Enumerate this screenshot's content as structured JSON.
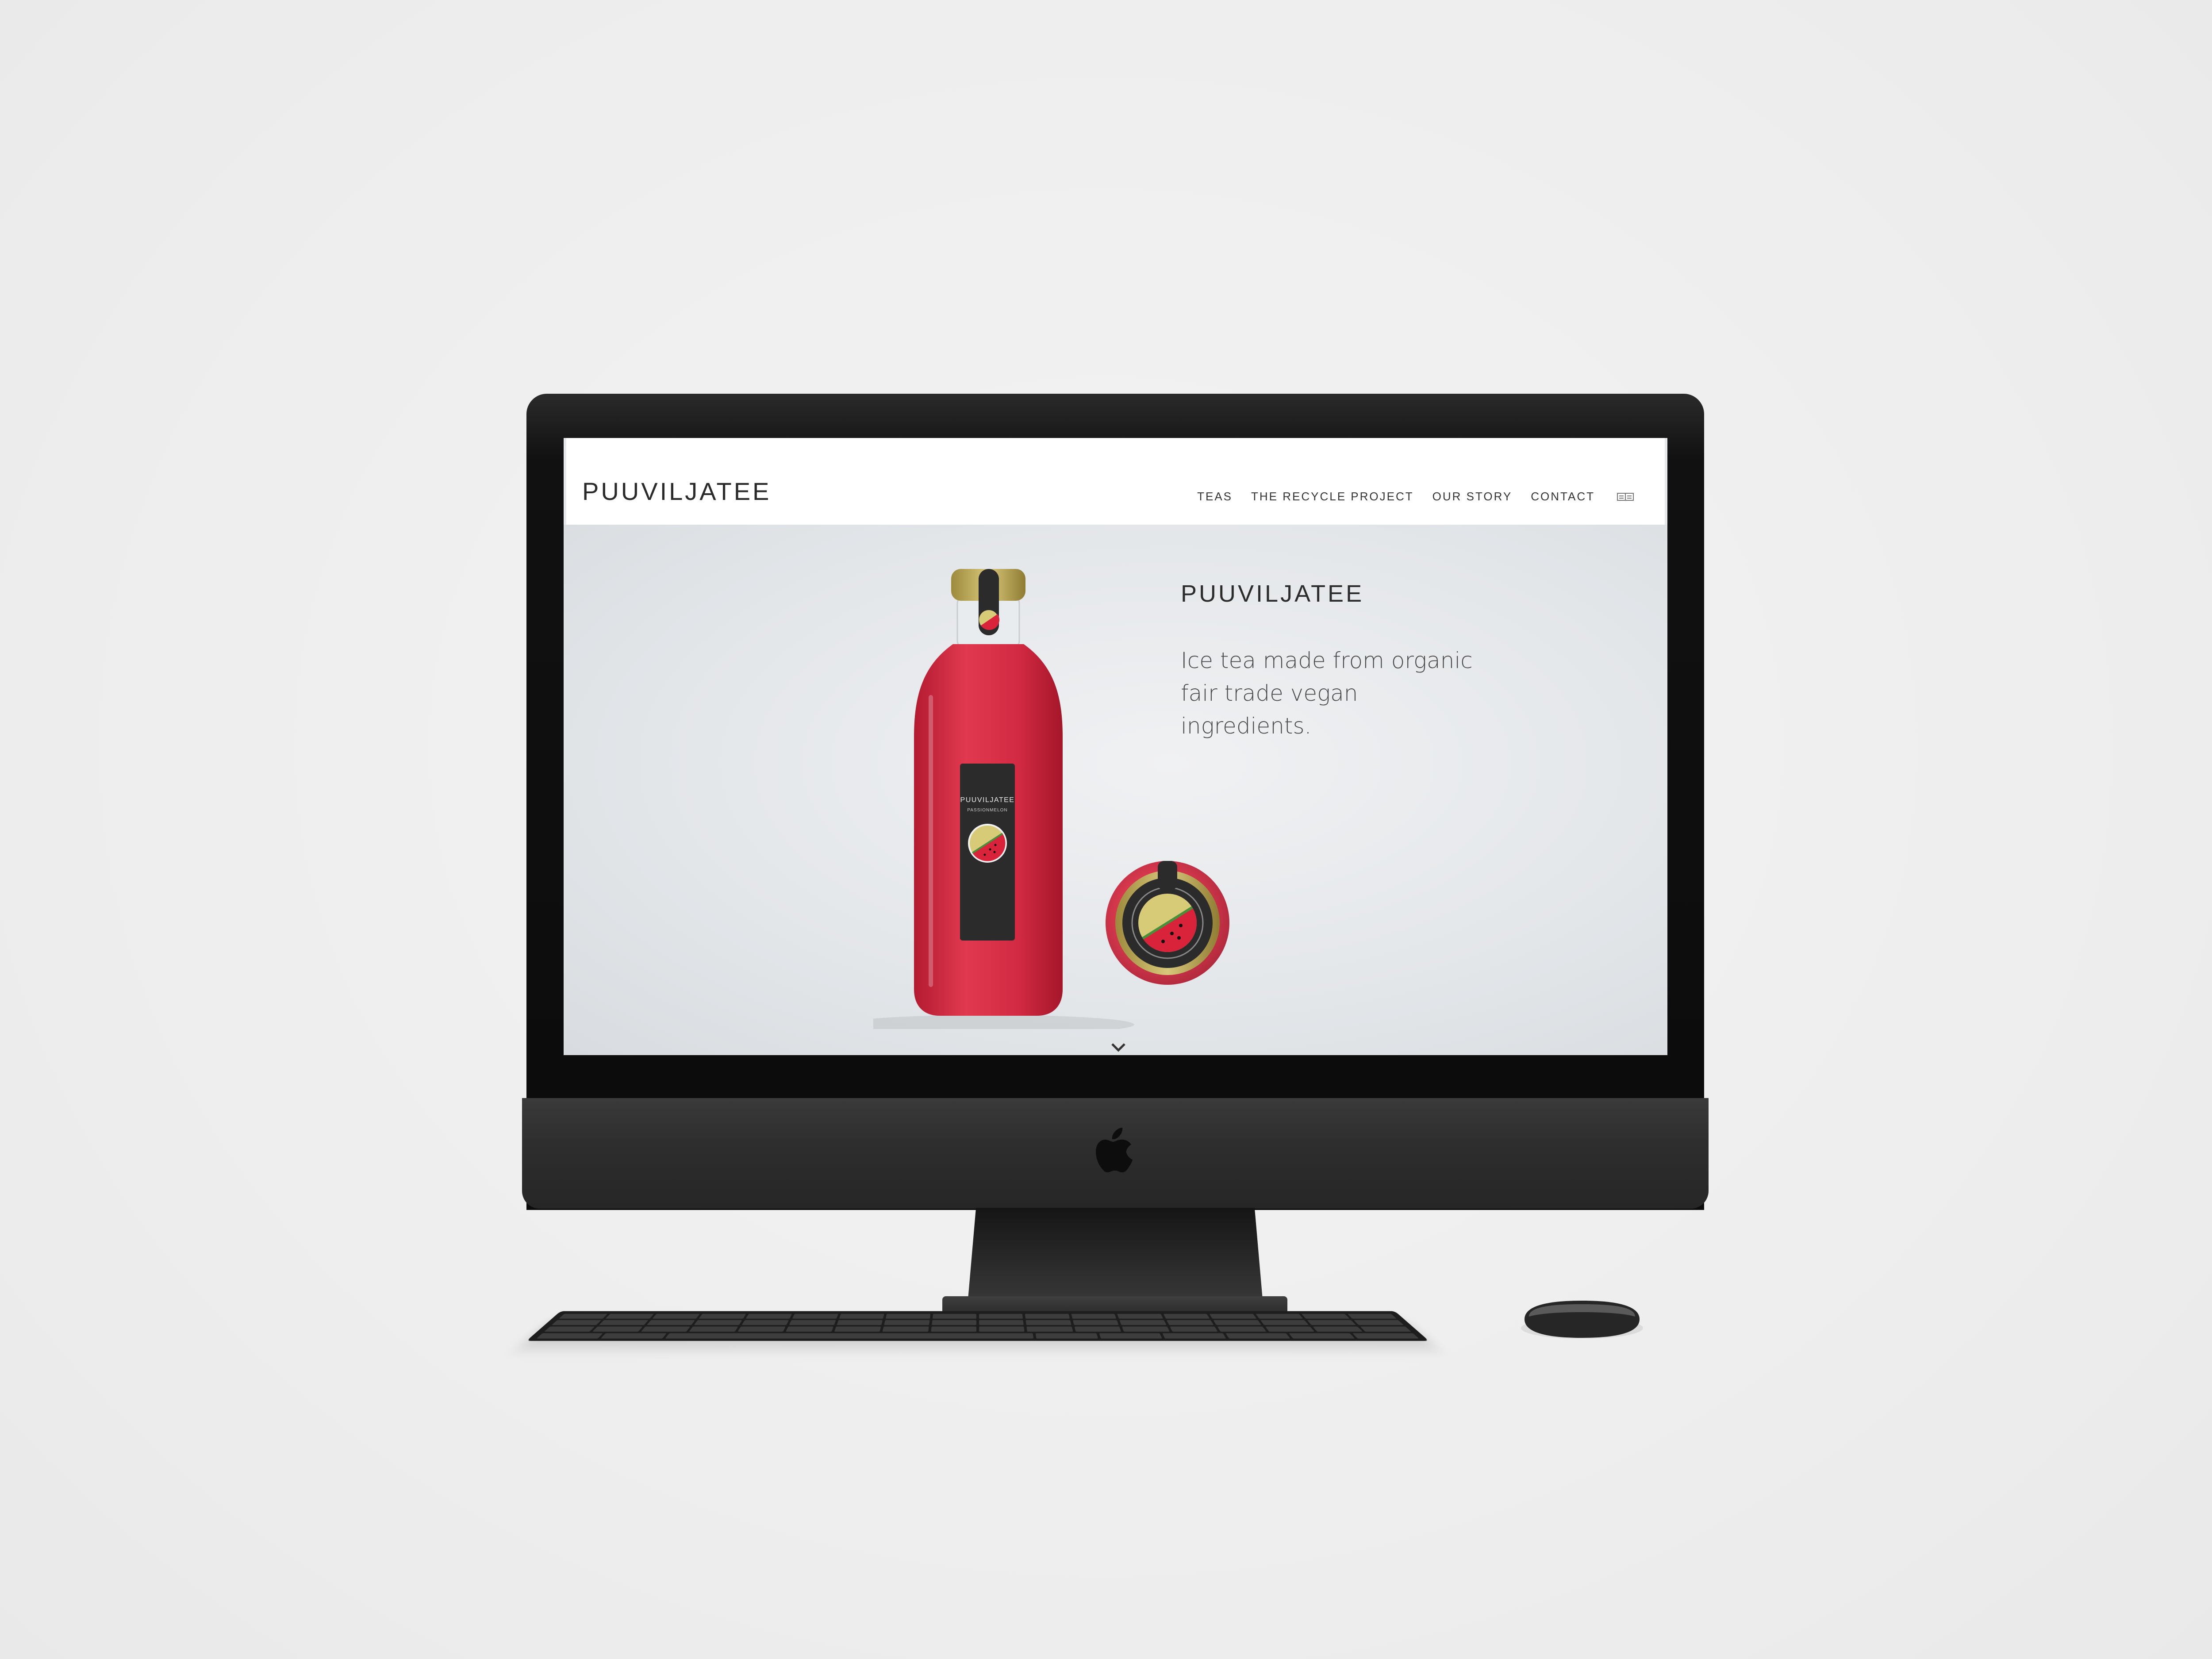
{
  "site": {
    "brand": "PUUVILJATEE",
    "nav": [
      {
        "label": "TEAS"
      },
      {
        "label": "THE RECYCLE PROJECT"
      },
      {
        "label": "OUR STORY"
      },
      {
        "label": "CONTACT"
      }
    ],
    "cart_icon": "cart-icon"
  },
  "hero": {
    "title": "PUUVILJATEE",
    "description": "Ice tea made from organic fair trade vegan ingredients.",
    "bottle_label": {
      "brand": "PUUVILJATEE",
      "flavor": "PASSIONMELON"
    },
    "scroll_icon": "chevron-down-icon"
  },
  "colors": {
    "liquid": "#d5283f",
    "lid_gold": "#c7b25a",
    "label_dark": "#2b2b2b",
    "melon_red": "#d8233a",
    "melon_yellow": "#d8cb78"
  }
}
